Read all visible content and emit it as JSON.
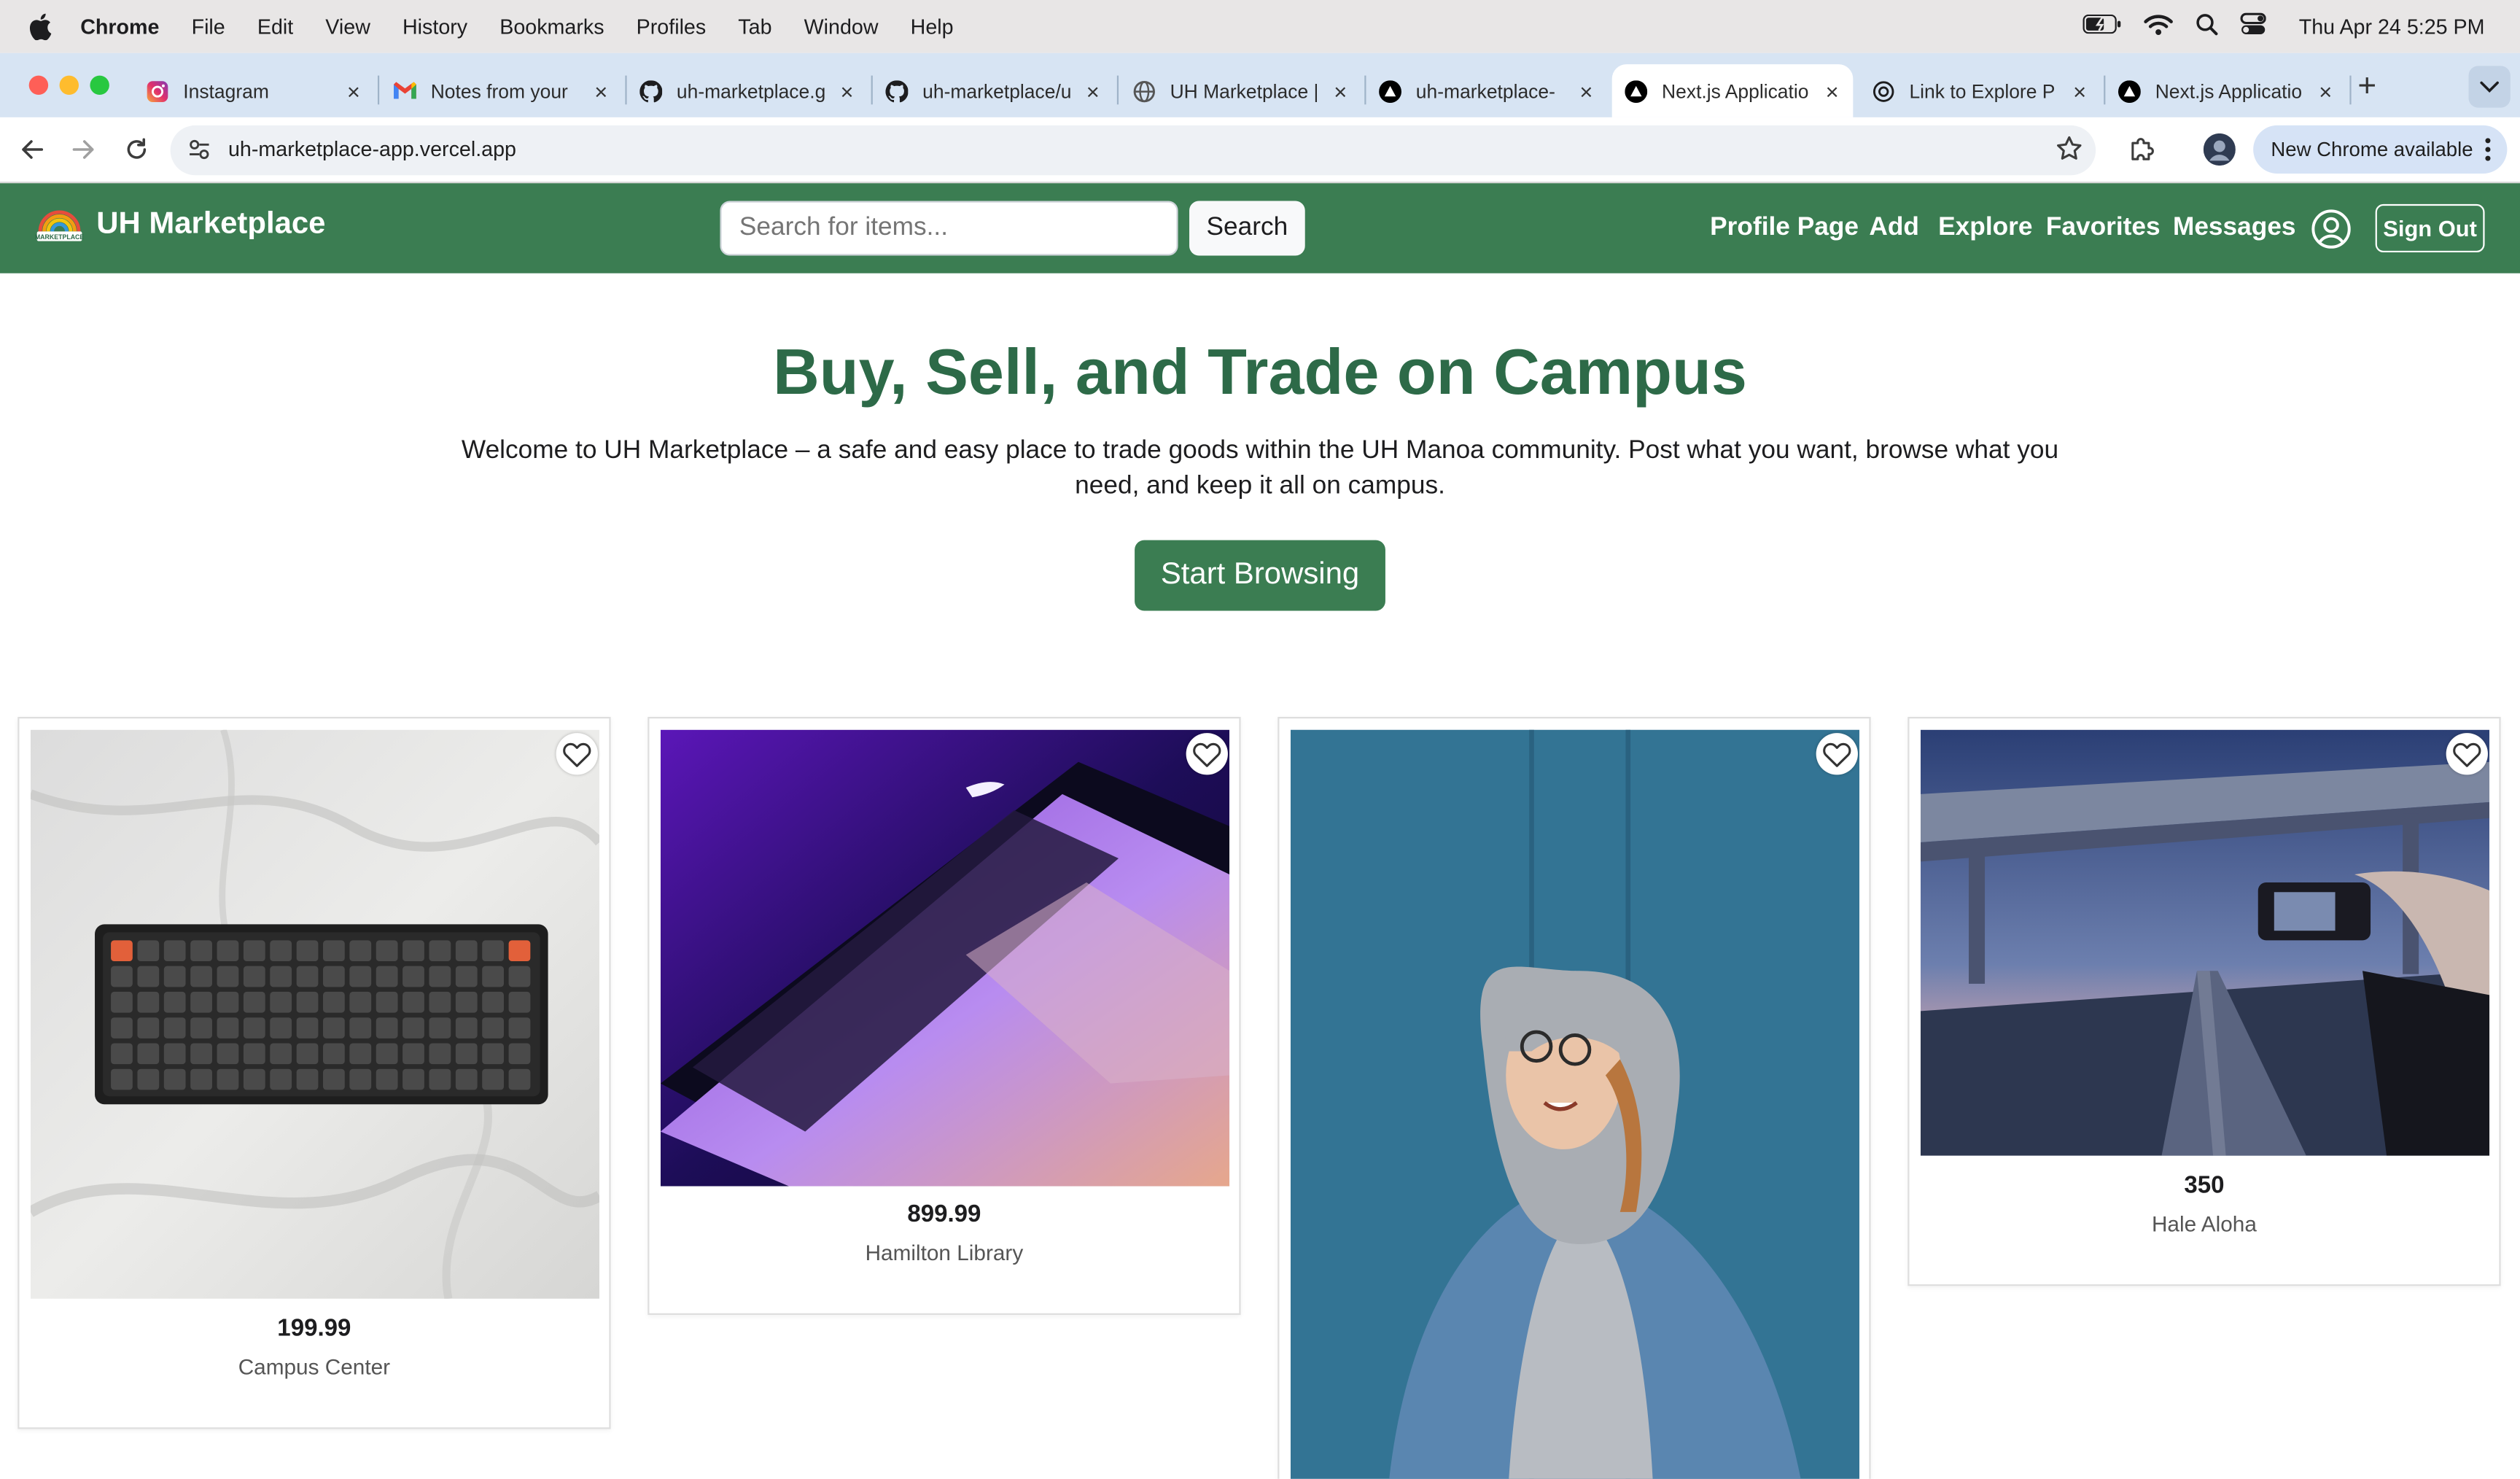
{
  "menubar": {
    "app_name": "Chrome",
    "items": [
      "File",
      "Edit",
      "View",
      "History",
      "Bookmarks",
      "Profiles",
      "Tab",
      "Window",
      "Help"
    ],
    "clock": "Thu Apr 24  5:25 PM"
  },
  "tabs": [
    {
      "title": "Instagram",
      "icon": "instagram-icon",
      "active": false
    },
    {
      "title": "Notes from your",
      "icon": "gmail-icon",
      "active": false
    },
    {
      "title": "uh-marketplace.g",
      "icon": "github-icon",
      "active": false
    },
    {
      "title": "uh-marketplace/u",
      "icon": "github-icon",
      "active": false
    },
    {
      "title": "UH Marketplace |",
      "icon": "globe-icon",
      "active": false
    },
    {
      "title": "uh-marketplace-",
      "icon": "vercel-icon",
      "active": false
    },
    {
      "title": "Next.js Applicatio",
      "icon": "vercel-icon",
      "active": true
    },
    {
      "title": "Link to Explore P",
      "icon": "openai-icon",
      "active": false
    },
    {
      "title": "Next.js Applicatio",
      "icon": "vercel-icon",
      "active": false
    }
  ],
  "toolbar": {
    "url": "uh-marketplace-app.vercel.app",
    "update_label": "New Chrome available"
  },
  "site": {
    "brand": "UH Marketplace",
    "logo_text": "UH MARKETPLACE",
    "search_placeholder": "Search for items...",
    "search_button": "Search",
    "nav": [
      "Profile Page",
      "Add",
      "Explore",
      "Favorites",
      "Messages"
    ],
    "sign_out": "Sign Out",
    "accent_color": "#3b7d52",
    "title_color": "#2d6a48"
  },
  "hero": {
    "title": "Buy, Sell, and Trade on Campus",
    "description": "Welcome to UH Marketplace – a safe and easy place to trade goods within the UH Manoa community. Post what you want, browse what you need, and keep it all on campus.",
    "cta": "Start Browsing"
  },
  "listings": [
    {
      "price": "199.99",
      "location": "Campus Center",
      "image": "mechanical-keyboard"
    },
    {
      "price": "899.99",
      "location": "Hamilton Library",
      "image": "laptop"
    },
    {
      "price": "",
      "location": "",
      "image": "denim-jacket-person"
    },
    {
      "price": "350",
      "location": "Hale Aloha",
      "image": "camera-under-bridge"
    }
  ]
}
